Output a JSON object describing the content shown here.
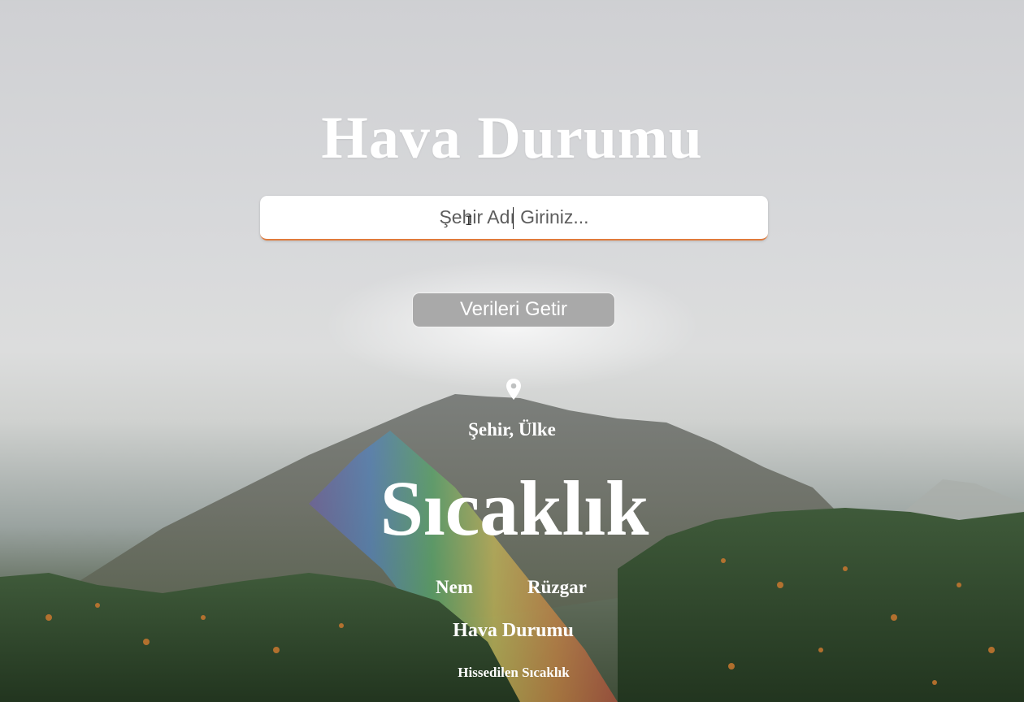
{
  "app": {
    "title": "Hava Durumu"
  },
  "search": {
    "placeholder": "Şehir Adı Giriniz...",
    "value": ""
  },
  "actions": {
    "fetch_label": "Verileri Getir"
  },
  "weather": {
    "location": "Şehir, Ülke",
    "temperature": "Sıcaklık",
    "humidity": "Nem",
    "wind": "Rüzgar",
    "condition": "Hava Durumu",
    "feels_like": "Hissedilen Sıcaklık"
  },
  "icons": {
    "location": "map-pin-icon",
    "cursor": "text-cursor-icon"
  },
  "colors": {
    "text": "#ffffff",
    "input_accent": "#e07b3c",
    "button_bg": "#a9a9a9"
  }
}
